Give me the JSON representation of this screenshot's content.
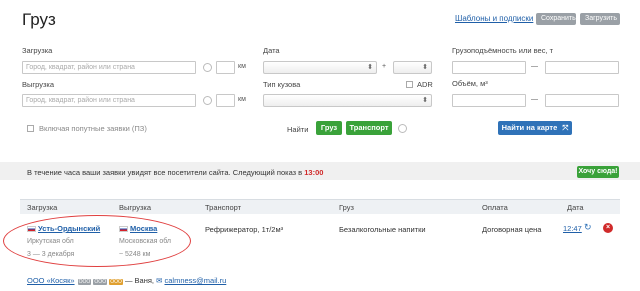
{
  "page": {
    "title": "Груз",
    "templates_link": "Шаблоны и подписки",
    "save_button": "Сохранить",
    "load_button": "Загрузить"
  },
  "form": {
    "loading": {
      "label": "Загрузка",
      "placeholder": "Город, квадрат, район или страна",
      "unit": "км"
    },
    "unloading": {
      "label": "Выгрузка",
      "placeholder": "Город, квадрат, район или страна",
      "unit": "км"
    },
    "date": {
      "label": "Дата",
      "plus": "+"
    },
    "body_type": {
      "label": "Тип кузова",
      "adr_label": "ADR"
    },
    "capacity": {
      "label": "Грузоподъёмность или вес, т",
      "dash": "—"
    },
    "volume": {
      "label": "Объём, м³",
      "dash": "—"
    },
    "include_partial": "Включая попутные заявки (ПЗ)",
    "find_label": "Найти",
    "find_cargo": "Груз",
    "find_transport": "Транспорт",
    "map_button": "Найти на карте"
  },
  "banner": {
    "text": "В течение часа ваши заявки увидят все посетители сайта. Следующий показ в",
    "time": "13:00",
    "cta": "Хочу сюда!"
  },
  "table": {
    "headers": [
      "Загрузка",
      "Выгрузка",
      "Транспорт",
      "Груз",
      "Оплата",
      "Дата"
    ],
    "row": {
      "from_city": "Усть-Ордынский",
      "from_region": "Иркутская обл",
      "dates": "3 — 3 декабря",
      "to_city": "Москва",
      "to_region": "Московская обл",
      "distance": "~ 5248 км",
      "transport": "Рефрижератор, 1т/2м³",
      "cargo": "Безалкогольные напитки",
      "payment": "Договорная цена",
      "time": "12:47"
    }
  },
  "footer": {
    "company": "ООО «Косяк»",
    "badges": [
      "ООО",
      "ООО",
      "ООО"
    ],
    "contact": "— Ваня,",
    "email": "calmness@mail.ru"
  },
  "colors": {
    "accent_green": "#3aa23a",
    "accent_blue": "#2f72b8",
    "link": "#1f5fa8",
    "alert_red": "#d02a2a"
  }
}
